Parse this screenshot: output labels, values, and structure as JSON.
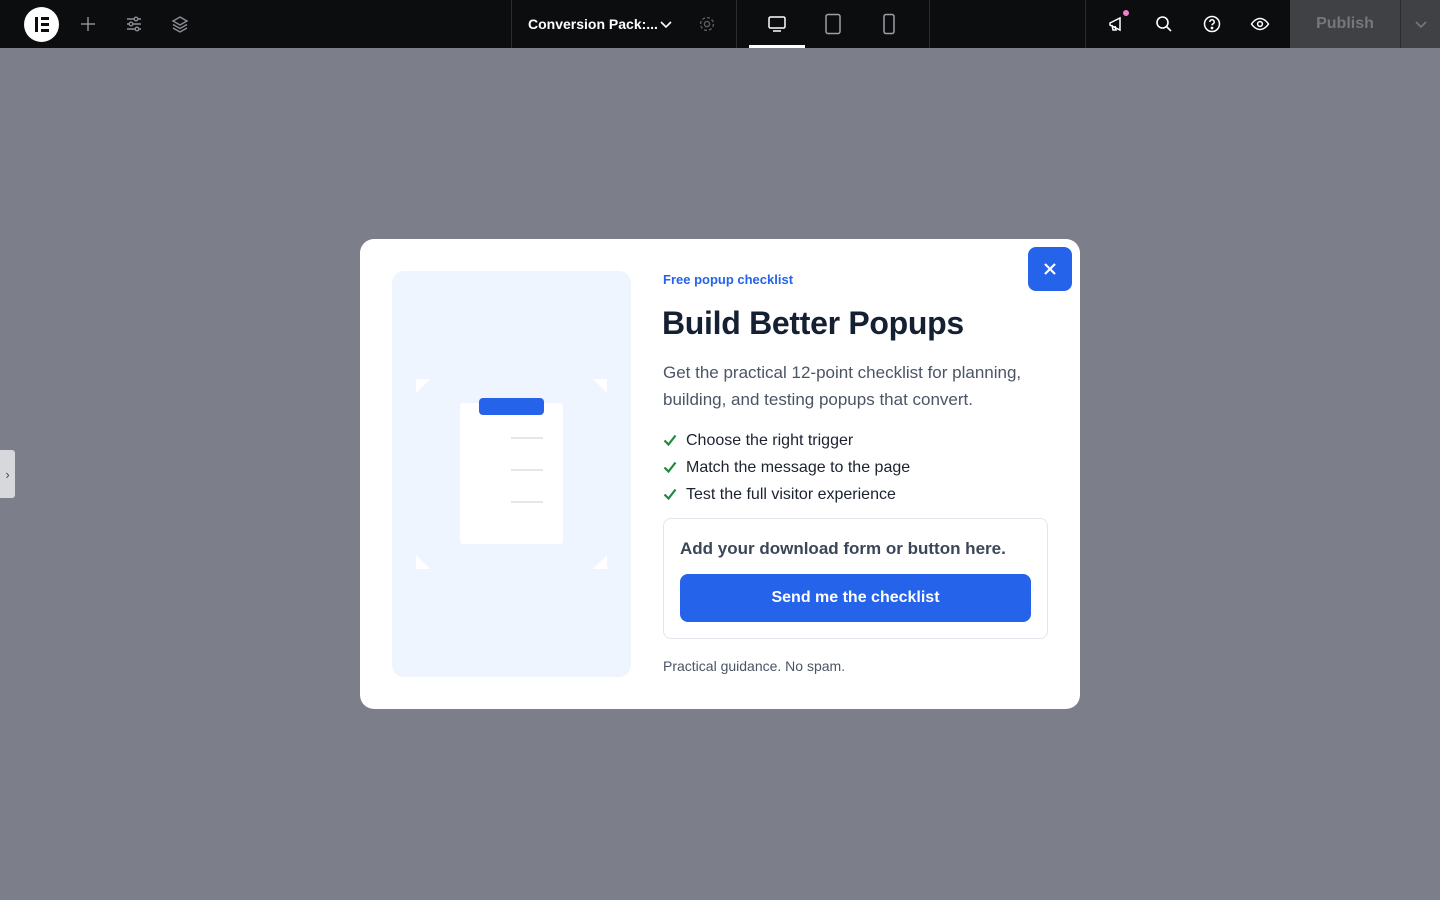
{
  "topbar": {
    "document_title": "Conversion Pack:...",
    "publish_label": "Publish",
    "active_device": "desktop"
  },
  "popup": {
    "eyebrow": "Free popup checklist",
    "title": "Build Better Popups",
    "description": "Get the practical 12-point checklist for planning, building, and testing popups that convert.",
    "bullets": [
      "Choose the right trigger",
      "Match the message to the page",
      "Test the full visitor experience"
    ],
    "form_label": "Add your download form or button here.",
    "cta_label": "Send me the checklist",
    "footnote": "Practical guidance. No spam."
  },
  "colors": {
    "accent": "#2563eb",
    "check": "#1f8a3d",
    "canvas": "#7c7f8a",
    "topbar": "#0c0d0e"
  },
  "icons": [
    "elementor-logo-icon",
    "plus-icon",
    "sliders-icon",
    "layers-icon",
    "chevron-down-icon",
    "gear-icon",
    "desktop-icon",
    "tablet-icon",
    "mobile-icon",
    "megaphone-icon",
    "search-icon",
    "help-icon",
    "eye-icon",
    "close-icon",
    "check-icon"
  ]
}
